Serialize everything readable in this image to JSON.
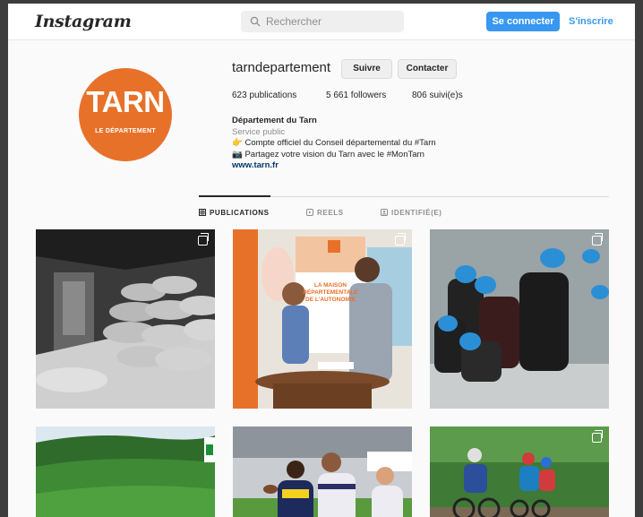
{
  "header": {
    "logo": "Instagram",
    "search_placeholder": "Rechercher",
    "login_label": "Se connecter",
    "signup_label": "S'inscrire"
  },
  "profile": {
    "avatar_brand": "TARN",
    "avatar_subtitle": "LE DÉPARTEMENT",
    "avatar_color": "#e8712a",
    "username": "tarndepartement",
    "follow_label": "Suivre",
    "contact_label": "Contacter",
    "stats": {
      "posts": "623 publications",
      "followers": "5 661 followers",
      "following": "806 suivi(e)s"
    },
    "bio": {
      "name": "Département du Tarn",
      "category": "Service public",
      "line1": "👉 Compte officiel du Conseil départemental du #Tarn",
      "line2": "📷 Partagez votre vision du Tarn avec le #MonTarn",
      "link": "www.tarn.fr"
    }
  },
  "tabs": [
    {
      "label": "PUBLICATIONS",
      "icon": "grid-icon",
      "active": true
    },
    {
      "label": "REELS",
      "icon": "reels-icon",
      "active": false
    },
    {
      "label": "IDENTIFIÉ(E)",
      "icon": "tagged-icon",
      "active": false
    }
  ],
  "posts": [
    {
      "name": "post-warehouse-sacks",
      "multi": true
    },
    {
      "name": "post-maison-autonomie",
      "multi": true,
      "sign_lines": [
        "LA MAISON",
        "DÉPARTEMENTALE",
        "DE L'AUTONOMIE"
      ]
    },
    {
      "name": "post-triathlon-swimmers",
      "multi": true
    },
    {
      "name": "post-forest-landscape",
      "multi": false
    },
    {
      "name": "post-rugby-match",
      "multi": false
    },
    {
      "name": "post-mountain-bike",
      "multi": true
    }
  ],
  "colors": {
    "accent": "#3897f0",
    "text": "#262626",
    "muted": "#8e8e8e",
    "link": "#00376b"
  }
}
